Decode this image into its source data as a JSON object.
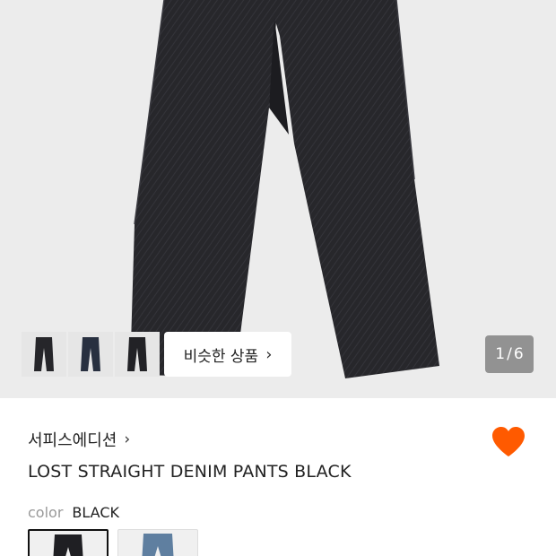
{
  "product_image": {
    "counter_current": "1",
    "counter_separator": "/",
    "counter_total": "6",
    "similar_button_label": "비슷한 상품",
    "thumbnails": [
      "black-denim-thumb",
      "navy-denim-thumb",
      "black-denim-thumb"
    ]
  },
  "product": {
    "brand": "서피스에디션",
    "name": "LOST STRAIGHT DENIM PANTS BLACK",
    "color_label": "color",
    "color_value": "BLACK",
    "color_options": [
      "BLACK",
      "BLUE"
    ],
    "wishlisted": true
  },
  "colors": {
    "accent": "#ff5a00",
    "denim_black": "#262629",
    "denim_navy": "#283040",
    "denim_blue": "#5f7fa0"
  }
}
